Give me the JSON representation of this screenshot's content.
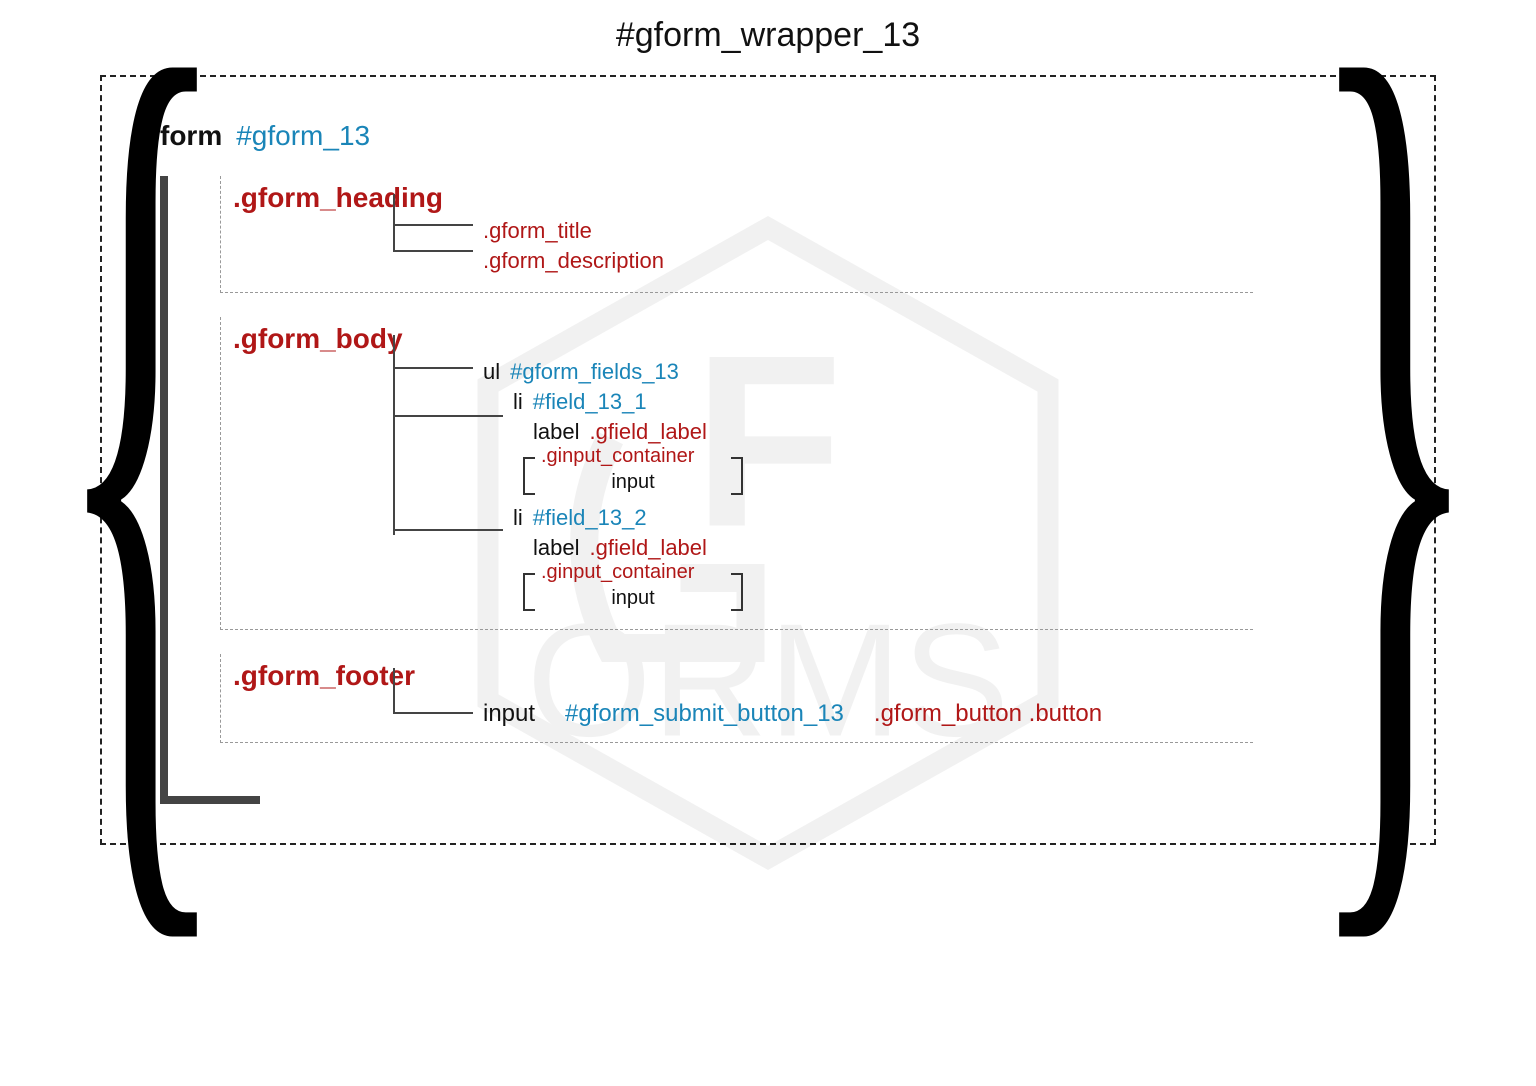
{
  "title": "#gform_wrapper_13",
  "form": {
    "tag": "form",
    "id": "#gform_13"
  },
  "heading": {
    "class": ".gform_heading",
    "children": {
      "title": ".gform_title",
      "description": ".gform_description"
    }
  },
  "body": {
    "class": ".gform_body",
    "ul": {
      "tag": "ul",
      "id": "#gform_fields_13"
    },
    "fields": [
      {
        "tag": "li",
        "id": "#field_13_1",
        "label_tag": "label",
        "label_class": ".gfield_label",
        "container_class": ".ginput_container",
        "input": "input"
      },
      {
        "tag": "li",
        "id": "#field_13_2",
        "label_tag": "label",
        "label_class": ".gfield_label",
        "container_class": ".ginput_container",
        "input": "input"
      }
    ]
  },
  "footer": {
    "class": ".gform_footer",
    "input_tag": "input",
    "input_id": "#gform_submit_button_13",
    "input_classes": ".gform_button .button"
  }
}
